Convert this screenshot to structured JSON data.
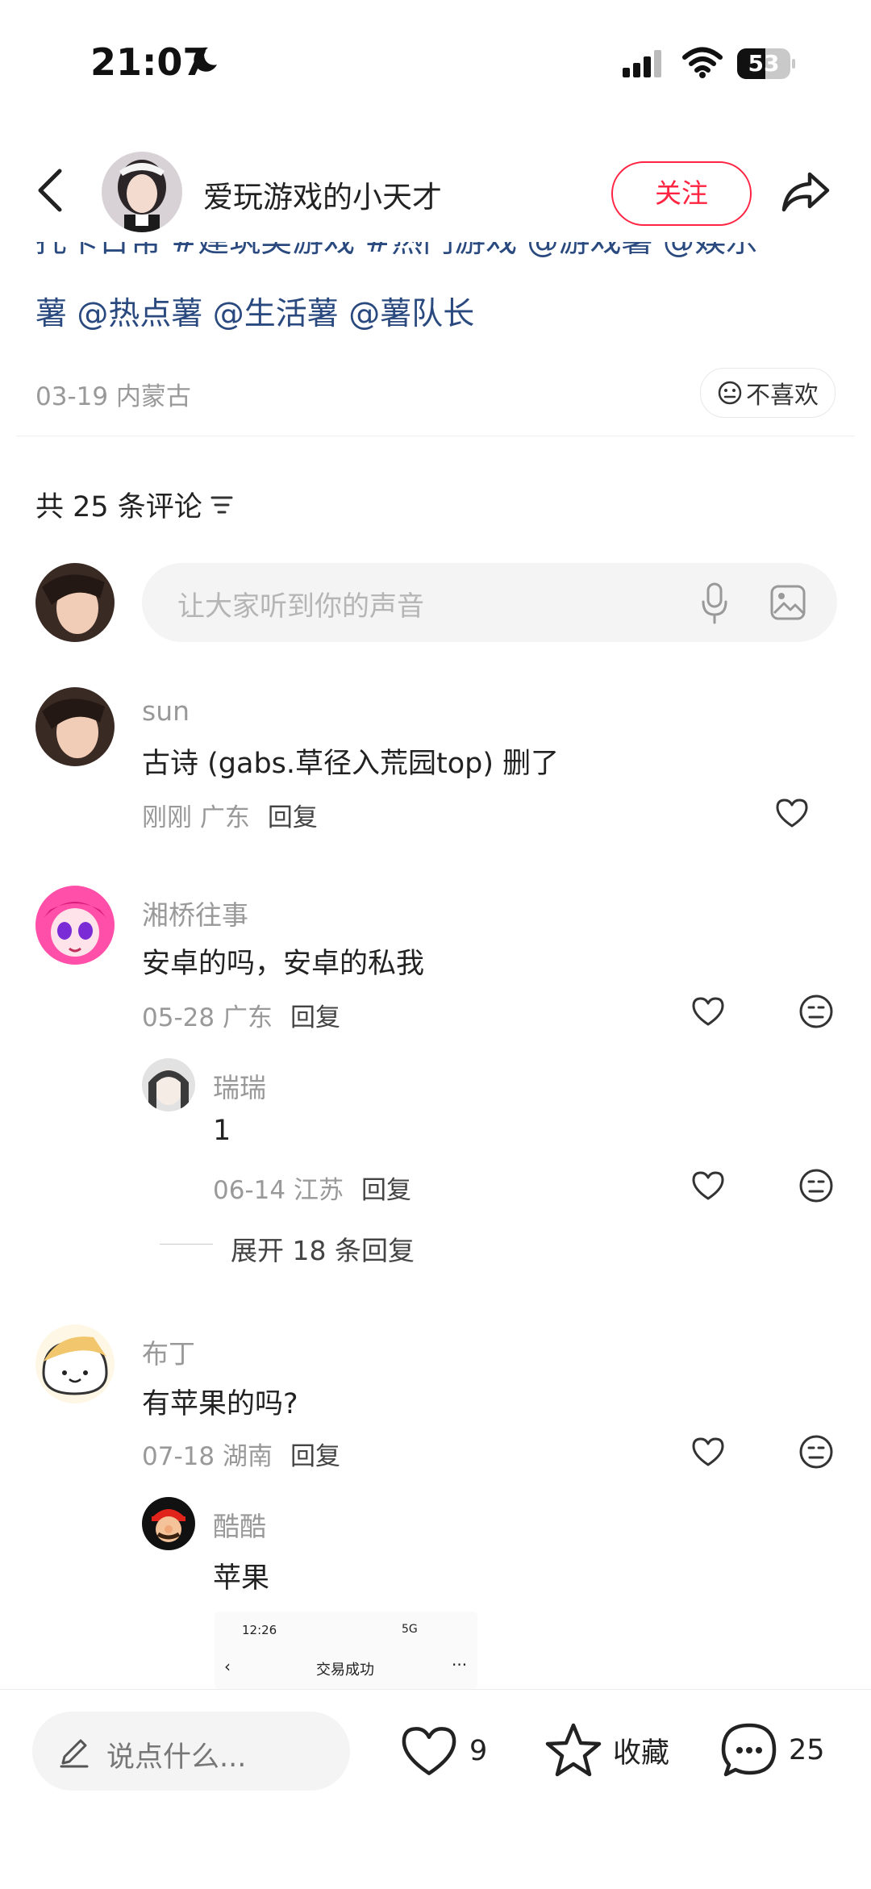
{
  "status_bar": {
    "time": "21:07",
    "battery": "53"
  },
  "header": {
    "author_name": "爱玩游戏的小天才",
    "follow_label": "关注"
  },
  "post": {
    "clipped_line": "托卡日常 #建筑类游戏 #热门游戏 @游戏薯 @娱乐",
    "tags_line": "薯 @热点薯 @生活薯 @薯队长",
    "date_location": "03-19 内蒙古",
    "dislike_label": "不喜欢"
  },
  "comments_section": {
    "count_label": "共 25 条评论",
    "input_placeholder": "让大家听到你的声音",
    "comments": [
      {
        "user": "sun",
        "text": "古诗 (gabs.草径入荒园top) 删了",
        "date": "刚刚",
        "location": "广东",
        "reply": "回复"
      },
      {
        "user": "湘桥往事",
        "text": "安卓的吗，安卓的私我",
        "date": "05-28",
        "location": "广东",
        "reply": "回复",
        "replies": [
          {
            "user": "瑞瑞",
            "text": "1",
            "date": "06-14",
            "location": "江苏",
            "reply": "回复"
          }
        ],
        "expand_label": "展开 18 条回复"
      },
      {
        "user": "布丁",
        "text": "有苹果的吗?",
        "date": "07-18",
        "location": "湖南",
        "reply": "回复",
        "replies": [
          {
            "user": "酷酷",
            "text": "苹果",
            "screenshot": {
              "time": "12:26",
              "signal": "5G",
              "title": "交易成功",
              "more": "···",
              "back": "‹"
            }
          }
        ]
      }
    ]
  },
  "bottom_bar": {
    "say_placeholder": "说点什么...",
    "likes": "9",
    "collect_label": "收藏",
    "comments": "25"
  },
  "colors": {
    "accent": "#ff2442",
    "link": "#2a4a7f",
    "muted": "#999999"
  }
}
